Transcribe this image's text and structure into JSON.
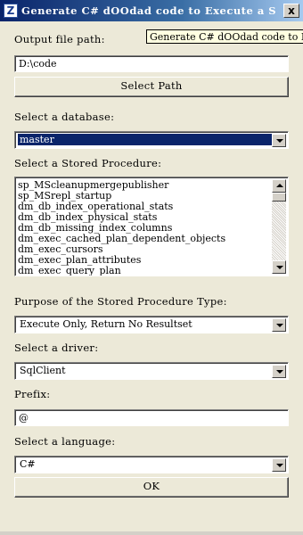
{
  "window": {
    "title": "Generate C# dOOdad code to Execute a St...",
    "close_glyph": "x",
    "tooltip": "Generate C# dOOdad code to Execute a Stored Procedure"
  },
  "output": {
    "label": "Output file path:",
    "value": "D:\\code",
    "select_path_button": "Select Path"
  },
  "database": {
    "label": "Select a database:",
    "selected": "master"
  },
  "stored_procedure": {
    "label": "Select a Stored Procedure:",
    "items": [
      "sp_MScleanupmergepublisher",
      "sp_MSrepl_startup",
      "dm_db_index_operational_stats",
      "dm_db_index_physical_stats",
      "dm_db_missing_index_columns",
      "dm_exec_cached_plan_dependent_objects",
      "dm_exec_cursors",
      "dm_exec_plan_attributes",
      "dm_exec_query_plan"
    ]
  },
  "purpose": {
    "label": "Purpose of the Stored Procedure Type:",
    "selected": "Execute Only, Return No Resultset"
  },
  "driver": {
    "label": "Select a driver:",
    "selected": "SqlClient"
  },
  "prefix": {
    "label": "Prefix:",
    "value": "@"
  },
  "language": {
    "label": "Select a language:",
    "selected": "C#"
  },
  "ok_button": "OK"
}
